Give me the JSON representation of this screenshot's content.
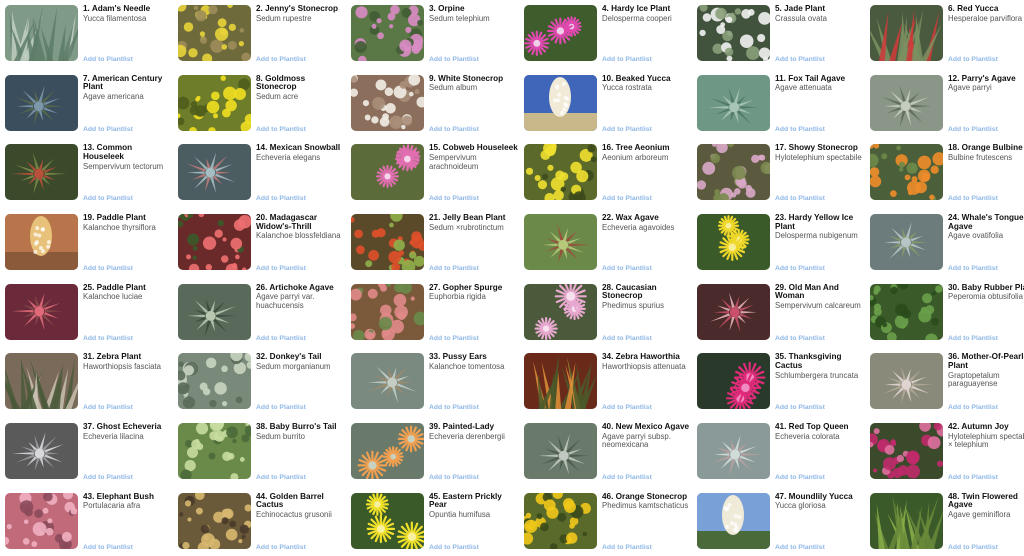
{
  "add_label": "Add to Plantlist",
  "plants": [
    {
      "num": "1.",
      "name": "Adam's Needle",
      "sci": "Yucca filamentosa",
      "thumb": "spiky-icon",
      "colors": [
        "#7f9a86",
        "#c3d1c4",
        "#5d7c68"
      ]
    },
    {
      "num": "2.",
      "name": "Jenny's Stonecrop",
      "sci": "Sedum rupestre",
      "thumb": "flowers-icon",
      "colors": [
        "#6f6a3c",
        "#e8d43a",
        "#9c8d5a"
      ]
    },
    {
      "num": "3.",
      "name": "Orpine",
      "sci": "Sedum telephium",
      "thumb": "flowers-icon",
      "colors": [
        "#5a7746",
        "#d98cc4",
        "#3f5c33"
      ]
    },
    {
      "num": "4.",
      "name": "Hardy Ice Plant",
      "sci": "Delosperma cooperi",
      "thumb": "daisy-icon",
      "colors": [
        "#3e5c2c",
        "#e049b0",
        "#f0d0e8"
      ]
    },
    {
      "num": "5.",
      "name": "Jade Plant",
      "sci": "Crassula ovata",
      "thumb": "flowers-icon",
      "colors": [
        "#41523d",
        "#f2f2f2",
        "#8aa07a"
      ]
    },
    {
      "num": "6.",
      "name": "Red Yucca",
      "sci": "Hesperaloe parviflora",
      "thumb": "spiky-icon",
      "colors": [
        "#4a5a3e",
        "#d13a3a",
        "#7a9161"
      ]
    },
    {
      "num": "7.",
      "name": "American Century Plant",
      "sci": "Agave americana",
      "thumb": "rosette-icon",
      "colors": [
        "#3a4e5e",
        "#7c97a8",
        "#5a6a4a"
      ]
    },
    {
      "num": "8.",
      "name": "Goldmoss Stonecrop",
      "sci": "Sedum acre",
      "thumb": "flowers-icon",
      "colors": [
        "#6e7d2a",
        "#f1df22",
        "#4e5d1c"
      ]
    },
    {
      "num": "9.",
      "name": "White Stonecrop",
      "sci": "Sedum album",
      "thumb": "flowers-icon",
      "colors": [
        "#8c6e5c",
        "#f1ede6",
        "#a88f7a"
      ]
    },
    {
      "num": "10.",
      "name": "Beaked Yucca",
      "sci": "Yucca rostrata",
      "thumb": "spike-bloom-icon",
      "colors": [
        "#3f66b9",
        "#f0ead6",
        "#c9b98a"
      ]
    },
    {
      "num": "11.",
      "name": "Fox Tail Agave",
      "sci": "Agave attenuata",
      "thumb": "rosette-icon",
      "colors": [
        "#6f9786",
        "#a8c6b6",
        "#4d7566"
      ]
    },
    {
      "num": "12.",
      "name": "Parry's Agave",
      "sci": "Agave parryi",
      "thumb": "rosette-icon",
      "colors": [
        "#8a9788",
        "#c5cdbf",
        "#5c6a58"
      ]
    },
    {
      "num": "13.",
      "name": "Common Houseleek",
      "sci": "Sempervivum tectorum",
      "thumb": "rosette-icon",
      "colors": [
        "#3a4a2a",
        "#b8503c",
        "#7c8a4a"
      ]
    },
    {
      "num": "14.",
      "name": "Mexican Snowball",
      "sci": "Echeveria elegans",
      "thumb": "rosette-icon",
      "colors": [
        "#4b5d61",
        "#a6bdc2",
        "#c07a7a"
      ]
    },
    {
      "num": "15.",
      "name": "Cobweb Houseleek",
      "sci": "Sempervivum arachnoideum",
      "thumb": "daisy-icon",
      "colors": [
        "#5b6b3a",
        "#e06eb0",
        "#f5d6ea"
      ]
    },
    {
      "num": "16.",
      "name": "Tree Aeonium",
      "sci": "Aeonium arboreum",
      "thumb": "flowers-icon",
      "colors": [
        "#5b6a2a",
        "#f0e030",
        "#3d4a1c"
      ]
    },
    {
      "num": "17.",
      "name": "Showy Stonecrop",
      "sci": "Hylotelephium spectabile",
      "thumb": "flowers-icon",
      "colors": [
        "#5b5a3e",
        "#d9a8c8",
        "#7a8a4e"
      ]
    },
    {
      "num": "18.",
      "name": "Orange Bulbine",
      "sci": "Bulbine frutescens",
      "thumb": "flowers-icon",
      "colors": [
        "#4a5f3a",
        "#f08c2a",
        "#6d8a4a"
      ]
    },
    {
      "num": "19.",
      "name": "Paddle Plant",
      "sci": "Kalanchoe thyrsiflora",
      "thumb": "spike-bloom-icon",
      "colors": [
        "#b8744a",
        "#e8c27a",
        "#8a5a3a"
      ]
    },
    {
      "num": "20.",
      "name": "Madagascar Widow's-Thrill",
      "sci": "Kalanchoe blossfeldiana",
      "thumb": "flowers-icon",
      "colors": [
        "#6b2a2a",
        "#f07070",
        "#3a5a2a"
      ]
    },
    {
      "num": "21.",
      "name": "Jelly Bean Plant",
      "sci": "Sedum ×rubrotinctum",
      "thumb": "flowers-icon",
      "colors": [
        "#5a4a2a",
        "#e0502a",
        "#8fb04a"
      ]
    },
    {
      "num": "22.",
      "name": "Wax Agave",
      "sci": "Echeveria agavoides",
      "thumb": "rosette-icon",
      "colors": [
        "#6b8a4a",
        "#b8c87a",
        "#a04a3a"
      ]
    },
    {
      "num": "23.",
      "name": "Hardy Yellow Ice Plant",
      "sci": "Delosperma nubigenum",
      "thumb": "daisy-icon",
      "colors": [
        "#3a5a2a",
        "#f0d82a",
        "#f7ee9a"
      ]
    },
    {
      "num": "24.",
      "name": "Whale's Tongue Agave",
      "sci": "Agave ovatifolia",
      "thumb": "rosette-icon",
      "colors": [
        "#6c7c7c",
        "#b7c6c4",
        "#8a9a6a"
      ]
    },
    {
      "num": "25.",
      "name": "Paddle Plant",
      "sci": "Kalanchoe luciae",
      "thumb": "rosette-icon",
      "colors": [
        "#6a2a3a",
        "#e06a7a",
        "#8a4a4a"
      ]
    },
    {
      "num": "26.",
      "name": "Artichoke Agave",
      "sci": "Agave parryi var. huachucensis",
      "thumb": "rosette-icon",
      "colors": [
        "#5a6a5a",
        "#b8c8b0",
        "#3a4a3a"
      ]
    },
    {
      "num": "27.",
      "name": "Gopher Spurge",
      "sci": "Euphorbia rigida",
      "thumb": "flowers-icon",
      "colors": [
        "#7a5a3a",
        "#e08a8a",
        "#6a8a4a"
      ]
    },
    {
      "num": "28.",
      "name": "Caucasian Stonecrop",
      "sci": "Phedimus spurius",
      "thumb": "daisy-icon",
      "colors": [
        "#4a5a3a",
        "#e8a8d0",
        "#f7e0ee"
      ]
    },
    {
      "num": "29.",
      "name": "Old Man And Woman",
      "sci": "Sempervivum calcareum",
      "thumb": "rosette-icon",
      "colors": [
        "#4a2a2a",
        "#c8506a",
        "#e8b0b8"
      ]
    },
    {
      "num": "30.",
      "name": "Baby Rubber Plant",
      "sci": "Peperomia obtusifolia",
      "thumb": "flowers-icon",
      "colors": [
        "#3a5a2a",
        "#6aa04a",
        "#2a4a1a"
      ]
    },
    {
      "num": "31.",
      "name": "Zebra Plant",
      "sci": "Haworthiopsis fasciata",
      "thumb": "spiky-icon",
      "colors": [
        "#7a6a5a",
        "#c8c0b0",
        "#4a5a3a"
      ]
    },
    {
      "num": "32.",
      "name": "Donkey's Tail",
      "sci": "Sedum morganianum",
      "thumb": "flowers-icon",
      "colors": [
        "#7a8a7a",
        "#c8d4c0",
        "#5a6a5a"
      ]
    },
    {
      "num": "33.",
      "name": "Pussy Ears",
      "sci": "Kalanchoe tomentosa",
      "thumb": "rosette-icon",
      "colors": [
        "#7a8a80",
        "#c4ccc4",
        "#a08a6a"
      ]
    },
    {
      "num": "34.",
      "name": "Zebra Haworthia",
      "sci": "Haworthiopsis attenuata",
      "thumb": "spiky-icon",
      "colors": [
        "#6a2a1a",
        "#e0903a",
        "#4a5a2a"
      ]
    },
    {
      "num": "35.",
      "name": "Thanksgiving Cactus",
      "sci": "Schlumbergera truncata",
      "thumb": "daisy-icon",
      "colors": [
        "#2a3a2a",
        "#e02a7a",
        "#f08ac0"
      ]
    },
    {
      "num": "36.",
      "name": "Mother-Of-Pearl-Plant",
      "sci": "Graptopetalum paraguayense",
      "thumb": "rosette-icon",
      "colors": [
        "#8a8a7a",
        "#e0d4d0",
        "#b0a898"
      ]
    },
    {
      "num": "37.",
      "name": "Ghost Echeveria",
      "sci": "Echeveria lilacina",
      "thumb": "rosette-icon",
      "colors": [
        "#5a5a5a",
        "#d8d8dc",
        "#9a9aa0"
      ]
    },
    {
      "num": "38.",
      "name": "Baby Burro's Tail",
      "sci": "Sedum burrito",
      "thumb": "flowers-icon",
      "colors": [
        "#6a8a4a",
        "#c8dca0",
        "#4a6a3a"
      ]
    },
    {
      "num": "39.",
      "name": "Painted-Lady",
      "sci": "Echeveria derenbergii",
      "thumb": "daisy-icon",
      "colors": [
        "#6a7a6a",
        "#f0a050",
        "#c8d0c0"
      ]
    },
    {
      "num": "40.",
      "name": "New Mexico Agave",
      "sci": "Agave parryi subsp. neomexicana",
      "thumb": "rosette-icon",
      "colors": [
        "#6a7a6a",
        "#c0c8c0",
        "#4a5a4a"
      ]
    },
    {
      "num": "41.",
      "name": "Red Top Queen",
      "sci": "Echeveria colorata",
      "thumb": "rosette-icon",
      "colors": [
        "#8a9a98",
        "#d0dcd8",
        "#b8a0a0"
      ]
    },
    {
      "num": "42.",
      "name": "Autumn Joy",
      "sci": "Hylotelephium spectabile × telephium",
      "thumb": "flowers-icon",
      "colors": [
        "#3a4a2a",
        "#c02a6a",
        "#e070a0"
      ]
    },
    {
      "num": "43.",
      "name": "Elephant Bush",
      "sci": "Portulacaria afra",
      "thumb": "flowers-icon",
      "colors": [
        "#c06a7a",
        "#f0b0c0",
        "#8a4a5a"
      ]
    },
    {
      "num": "44.",
      "name": "Golden Barrel Cactus",
      "sci": "Echinocactus grusonii",
      "thumb": "flowers-icon",
      "colors": [
        "#6a5a3a",
        "#d8b870",
        "#4a3a2a"
      ]
    },
    {
      "num": "45.",
      "name": "Eastern Prickly Pear",
      "sci": "Opuntia humifusa",
      "thumb": "daisy-icon",
      "colors": [
        "#3a5a2a",
        "#f0e02a",
        "#f7f0a0"
      ]
    },
    {
      "num": "46.",
      "name": "Orange Stonecrop",
      "sci": "Phedimus kamtschaticus",
      "thumb": "flowers-icon",
      "colors": [
        "#5a6a2a",
        "#f0c81a",
        "#3a4a1a"
      ]
    },
    {
      "num": "47.",
      "name": "Moundlily Yucca",
      "sci": "Yucca gloriosa",
      "thumb": "spike-bloom-icon",
      "colors": [
        "#7aa0d8",
        "#f0ead8",
        "#4a6a3a"
      ]
    },
    {
      "num": "48.",
      "name": "Twin Flowered Agave",
      "sci": "Agave geminiflora",
      "thumb": "spiky-icon",
      "colors": [
        "#3a5a2a",
        "#8ab04a",
        "#6a8a3a"
      ]
    }
  ]
}
